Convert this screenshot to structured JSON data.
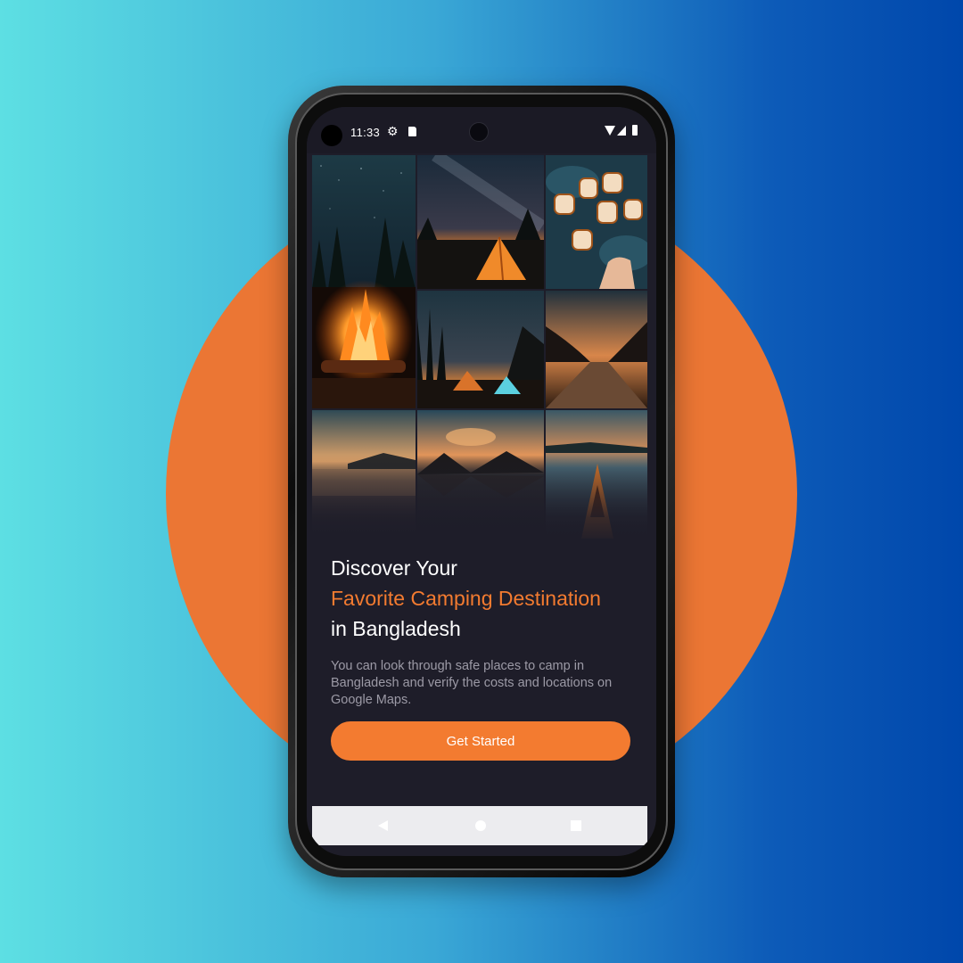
{
  "status_bar": {
    "time": "11:33",
    "icons": [
      "gear-icon",
      "sd-card-icon",
      "wifi-icon",
      "signal-icon",
      "battery-icon"
    ]
  },
  "gallery": {
    "tiles": [
      "campfire",
      "tent-under-milky-way",
      "roasting-marshmallows",
      "tents-at-lakeside-night",
      "road-through-mountains",
      "lake-sunset",
      "mountain-reflection-sunset",
      "kayak-on-lake"
    ]
  },
  "hero": {
    "line1": "Discover Your",
    "line2": "Favorite Camping Destination",
    "line3": "in Bangladesh",
    "description": "You can look through safe places to camp in Bangladesh and verify the costs and locations on Google Maps."
  },
  "cta": {
    "label": "Get Started"
  },
  "navigation_bar": {
    "icons": [
      "back-icon",
      "home-icon",
      "recents-icon"
    ]
  },
  "colors": {
    "accent": "#f37b30",
    "screen_background": "#1e1d29",
    "backdrop_circle": "#eb7634",
    "backdrop_gradient_start": "#5ddfe3",
    "backdrop_gradient_end": "#0047ab"
  }
}
